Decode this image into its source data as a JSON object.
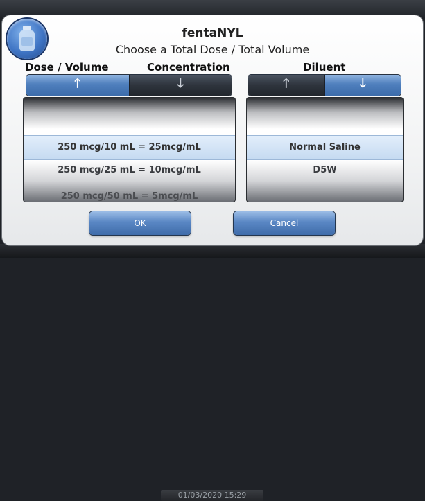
{
  "background": {
    "timestamp": "01/03/2020 15:29"
  },
  "dialog": {
    "icon": "medication-vial-icon",
    "title": "fentaNYL",
    "subtitle": "Choose a Total Dose / Total Volume"
  },
  "columns": {
    "dose_volume_label": "Dose / Volume",
    "concentration_label": "Concentration",
    "diluent_label": "Diluent"
  },
  "dose_list": {
    "items": [
      "250 mcg/10 mL = 25mcg/mL",
      "250 mcg/25 mL = 10mcg/mL",
      "250 mcg/50 mL = 5mcg/mL"
    ],
    "selected_index": 0
  },
  "diluent_list": {
    "items": [
      "Normal Saline",
      "D5W"
    ],
    "selected_index": 0
  },
  "buttons": {
    "ok": "OK",
    "cancel": "Cancel"
  },
  "colors": {
    "accent_blue": "#4f7fbd",
    "selection": "#c5daf1",
    "dark_button": "#2e343d"
  }
}
